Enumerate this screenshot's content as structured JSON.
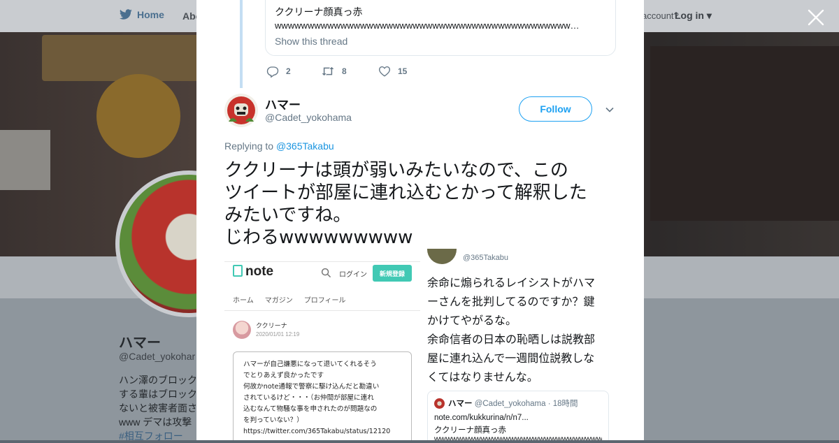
{
  "background": {
    "nav": {
      "home": "Home",
      "about": "Abo",
      "have_account": "account?",
      "login": "Log in"
    },
    "profile": {
      "name": "ハマー",
      "handle": "@Cadet_yokohar",
      "bio_lines": [
        "ハン澤のブロック",
        "する輩はブロック",
        "ないと被害者面さ",
        "www デマは攻撃"
      ],
      "hashtag": "#相互フォロー"
    }
  },
  "modal": {
    "quoted_card": {
      "text": "ククリーナ顔真っ赤",
      "laugh": "wwwwwwwwwwwwwwwwwwwwwwwwwwwwwwwwwwwwwwwwwwwwwwwwwwwwwwwwwwwwwwww...",
      "show_thread": "Show this thread"
    },
    "previous_actions": {
      "replies": "2",
      "retweets": "8",
      "likes": "15"
    },
    "author": {
      "name": "ハマー",
      "handle": "@Cadet_yokohama"
    },
    "follow_label": "Follow",
    "replying_to": {
      "prefix": "Replying to ",
      "handle": "@365Takabu"
    },
    "tweet_lines": [
      "ククリーナは頭が弱いみたいなので、この",
      "ツイートが部屋に連れ込むとかって解釈した",
      "みたいですね。",
      "じわるwwwwwwwww"
    ],
    "media": {
      "note": {
        "logo": "note",
        "login": "ログイン",
        "signup": "新規登録",
        "tabs": [
          "ホーム",
          "マガジン",
          "プロフィール"
        ],
        "user": "ククリーナ",
        "date": "2020/01/01 12:19",
        "body_lines": [
          "ハマーが自己嫌悪になって退いてくれるそう",
          "でとりあえず良かったです",
          "何故かnote通報で警察に駆け込んだと勘違い",
          "されているけど・・・（お仲間が部屋に連れ",
          "込むなんて物騒な事を申されたのが問題なの",
          "を判っていない？）",
          "https://twitter.com/365Takabu/status/12120"
        ]
      },
      "reply": {
        "handle": "@365Takabu",
        "lines": [
          "余命に煽られるレイシストがハマ",
          "ーさんを批判してるのですか？鍵",
          "かけてやがるな。",
          "余命信者の日本の恥晒しは説教部",
          "屋に連れ込んで一週間位説教しな",
          "くてはなりませんな。"
        ],
        "card": {
          "name": "ハマー",
          "handle": "@Cadet_yokohama · 18時間",
          "line1": "note.com/kukkurina/n/n7...",
          "line2": "ククリーナ顔真っ赤",
          "line3": "wwwwwwwwwwwwwwwwwwwwwwwwwwwwwwwwwwwwww"
        }
      }
    }
  },
  "colors": {
    "twitter_blue": "#1da1f2",
    "link_blue": "#1b95e0",
    "muted_gray": "#657786",
    "thread_line": "#c4def3",
    "note_green": "#41c9b4"
  },
  "icons": [
    "twitter-bird-icon",
    "close-icon",
    "reply-icon",
    "retweet-icon",
    "like-icon",
    "chevron-down-icon",
    "search-icon"
  ]
}
